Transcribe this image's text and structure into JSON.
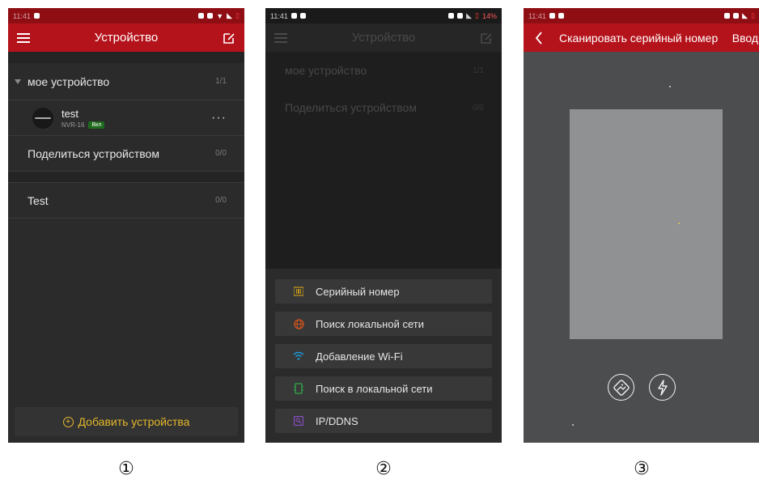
{
  "colors": {
    "titlebar_red": "#b5131b",
    "statusbar_red": "#8e0e14",
    "accent_yellow": "#e3b72a",
    "online_badge_green": "#1d6b1d"
  },
  "phone1": {
    "statusbar": {
      "time": "11:41"
    },
    "title": "Устройство",
    "menu_icon": "hamburger-icon",
    "edit_icon": "edit-icon",
    "group": {
      "label": "мое устройство",
      "count": "1/1"
    },
    "device": {
      "name": "test",
      "model": "NVR-16",
      "status": "Вкл",
      "more": "···"
    },
    "share": {
      "label": "Поделиться устройством",
      "count": "0/0"
    },
    "group2": {
      "label": "Test",
      "count": "0/0"
    },
    "add_button": "Добавить устройства"
  },
  "phone2": {
    "statusbar": {
      "time": "11:41",
      "battery": "14%"
    },
    "title": "Устройство",
    "dim_rows": [
      {
        "label": "мое устройство",
        "count": "1/1"
      },
      {
        "label": "Поделиться устройством",
        "count": "0/0"
      }
    ],
    "sheet": [
      {
        "label": "Серийный номер",
        "icon": "barcode-icon",
        "color": "#c49a1a"
      },
      {
        "label": "Поиск локальной сети",
        "icon": "globe-icon",
        "color": "#d4541c"
      },
      {
        "label": "Добавление Wi-Fi",
        "icon": "wifi-icon",
        "color": "#1e9ad6"
      },
      {
        "label": "Поиск в локальной сети",
        "icon": "device-icon",
        "color": "#2fa84a"
      },
      {
        "label": "IP/DDNS",
        "icon": "ip-icon",
        "color": "#8b4fc9"
      }
    ]
  },
  "phone3": {
    "statusbar": {
      "time": "11:41"
    },
    "title": "Сканировать серийный номер",
    "right_action": "Ввод",
    "back_icon": "back-chevron-icon",
    "gallery_icon": "gallery-icon",
    "flash_icon": "flash-icon"
  },
  "captions": [
    "①",
    "②",
    "③"
  ]
}
